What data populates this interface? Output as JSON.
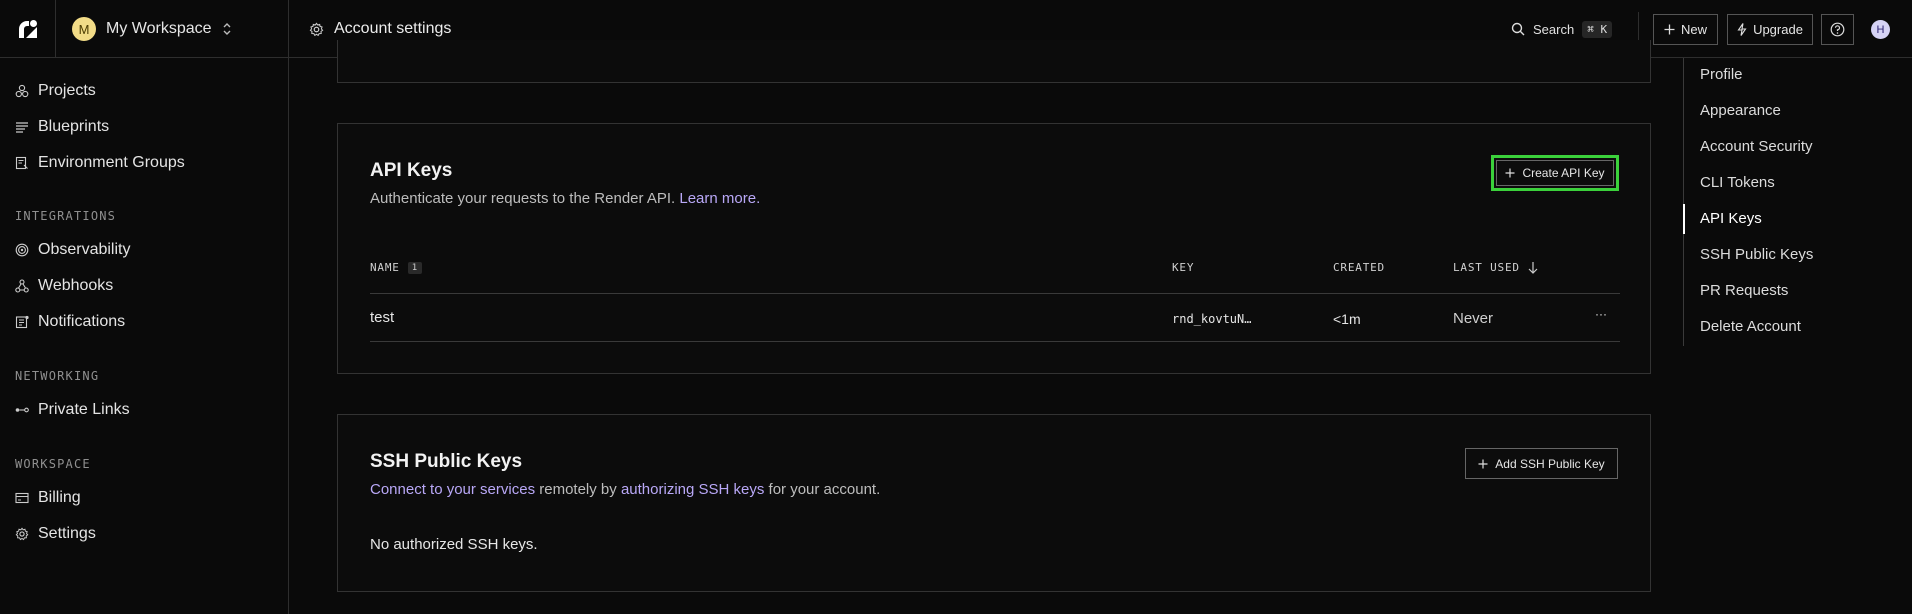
{
  "topbar": {
    "workspace_initial": "M",
    "workspace_name": "My Workspace",
    "breadcrumb": "Account settings",
    "search_label": "Search",
    "search_shortcut": "⌘ K",
    "new_label": "New",
    "upgrade_label": "Upgrade",
    "user_initial": "H"
  },
  "sidebar": {
    "items_top": [
      {
        "label": "Projects",
        "icon": "projects-icon"
      },
      {
        "label": "Blueprints",
        "icon": "blueprints-icon"
      },
      {
        "label": "Environment Groups",
        "icon": "env-groups-icon"
      }
    ],
    "integrations_heading": "INTEGRATIONS",
    "integrations": [
      {
        "label": "Observability",
        "icon": "observability-icon"
      },
      {
        "label": "Webhooks",
        "icon": "webhooks-icon"
      },
      {
        "label": "Notifications",
        "icon": "notifications-icon"
      }
    ],
    "networking_heading": "NETWORKING",
    "networking": [
      {
        "label": "Private Links",
        "icon": "private-links-icon"
      }
    ],
    "workspace_heading": "WORKSPACE",
    "workspace": [
      {
        "label": "Billing",
        "icon": "billing-icon"
      },
      {
        "label": "Settings",
        "icon": "settings-icon"
      }
    ]
  },
  "api_keys": {
    "title": "API Keys",
    "description": "Authenticate your requests to the Render API.",
    "learn_more": "Learn more.",
    "create_button": "Create API Key",
    "columns": {
      "name": "NAME",
      "name_badge": "1",
      "key": "KEY",
      "created": "CREATED",
      "last_used": "LAST USED"
    },
    "rows": [
      {
        "name": "test",
        "key": "rnd_kovtuN…",
        "created": "<1m",
        "last_used": "Never",
        "menu": "···"
      }
    ]
  },
  "ssh_keys": {
    "title": "SSH Public Keys",
    "desc_link1": "Connect to your services",
    "desc_mid": " remotely by ",
    "desc_link2": "authorizing SSH keys",
    "desc_end": " for your account.",
    "add_button": "Add SSH Public Key",
    "empty_text": "No authorized SSH keys."
  },
  "toc": {
    "items": [
      "Profile",
      "Appearance",
      "Account Security",
      "CLI Tokens",
      "API Keys",
      "SSH Public Keys",
      "PR Requests",
      "Delete Account"
    ],
    "active": "API Keys"
  },
  "colors": {
    "accent_link": "#b9a8f7",
    "highlight_border": "#3bd13b",
    "workspace_avatar": "#f2dc87"
  }
}
